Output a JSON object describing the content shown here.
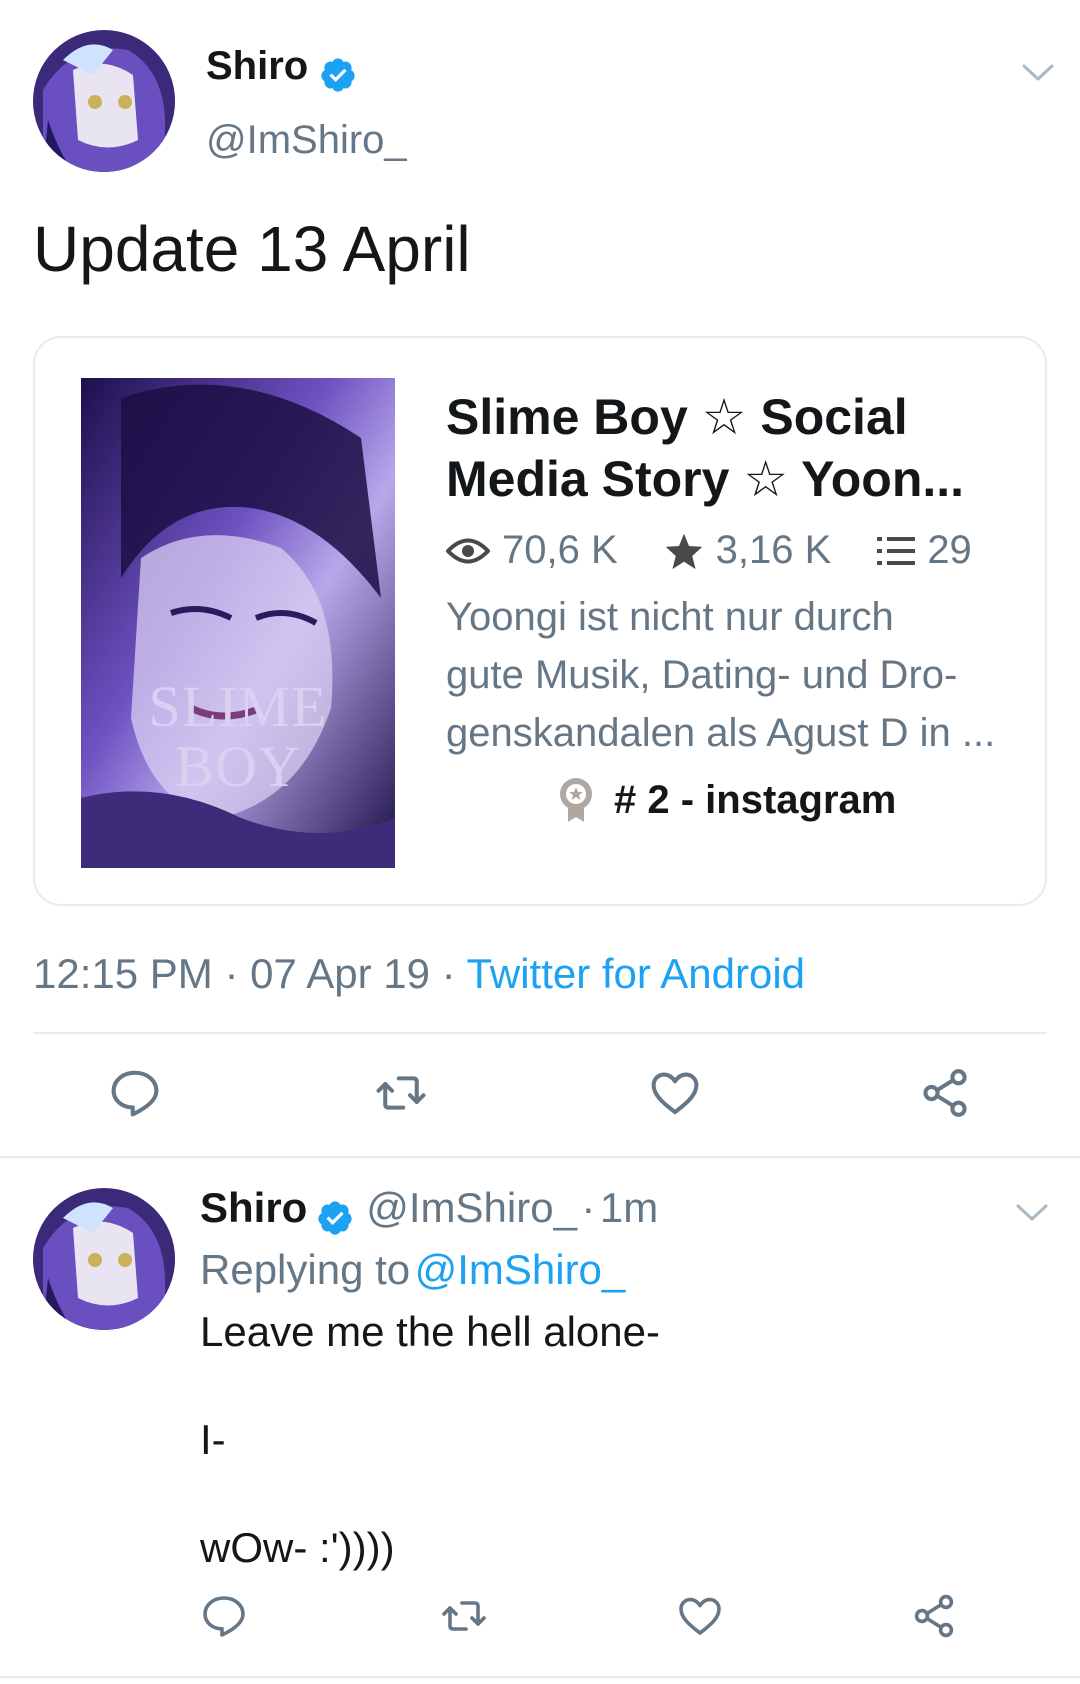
{
  "tweet": {
    "author_name": "Shiro",
    "author_handle": "@ImShiro_",
    "text": "Update 13 April",
    "card": {
      "title_line1": "Slime Boy ☆ Social",
      "title_line2": "Media Story ☆ Yoon...",
      "reads": "70,6 K",
      "votes": "3,16 K",
      "parts": "29",
      "description_line1": "Yoongi ist nicht nur durch",
      "description_line2": "gute Musik, Dating- und Dro-",
      "description_line3": "genskandalen als Agust D in ...",
      "rank": "# 2 - instagram",
      "cover_title_line1": "SLIME",
      "cover_title_line2": "BOY"
    },
    "time": "12:15 PM",
    "date": "07 Apr 19",
    "source": "Twitter for Android",
    "separator": "·"
  },
  "reply": {
    "author_name": "Shiro",
    "author_handle": "@ImShiro_",
    "time_ago": "1m",
    "replying_label": "Replying to",
    "replying_handle": "@ImShiro_",
    "line1": "Leave me the hell alone-",
    "line2": "I-",
    "line3": "wOw- :')))) "
  },
  "colors": {
    "accent": "#1da1f2",
    "text": "#14171a",
    "muted": "#657786",
    "border": "#e6ecf0"
  },
  "icons": [
    "verified-icon",
    "chevron-down-icon",
    "eye-icon",
    "star-icon",
    "list-icon",
    "badge-icon",
    "reply-icon",
    "retweet-icon",
    "like-icon",
    "share-icon"
  ]
}
